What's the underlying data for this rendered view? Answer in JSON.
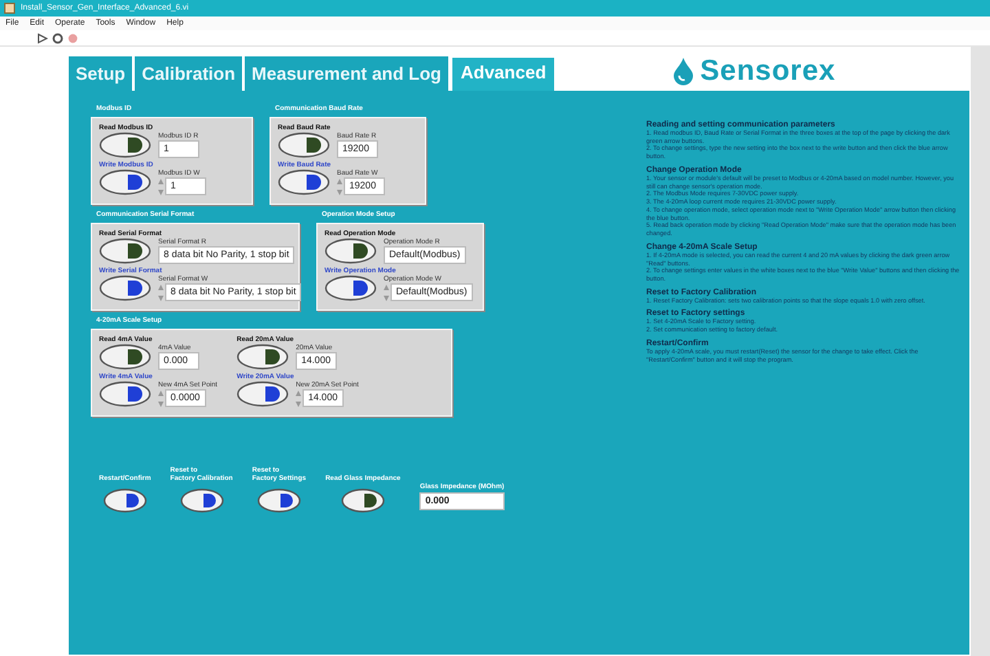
{
  "window": {
    "title": "Install_Sensor_Gen_Interface_Advanced_6.vi"
  },
  "menu": [
    "File",
    "Edit",
    "Operate",
    "Tools",
    "Window",
    "Help"
  ],
  "tabs": [
    {
      "label": "Setup",
      "selected": false
    },
    {
      "label": "Calibration",
      "selected": false
    },
    {
      "label": "Measurement and Log",
      "selected": false
    },
    {
      "label": "Advanced",
      "selected": true
    }
  ],
  "logo": {
    "text": "Sensorex"
  },
  "sections": [
    {
      "title": "Modbus ID",
      "columns": [
        [
          {
            "kind": "read",
            "button_label": "Read Modbus ID",
            "field_label": "Modbus ID R",
            "value": "1"
          },
          {
            "kind": "write",
            "button_label": "Write Modbus ID",
            "field_label": "Modbus ID W",
            "value": "1"
          }
        ]
      ]
    },
    {
      "title": "Communication Baud Rate",
      "columns": [
        [
          {
            "kind": "read",
            "button_label": "Read Baud Rate",
            "field_label": "Baud Rate R",
            "value": "19200"
          },
          {
            "kind": "write",
            "button_label": "Write Baud Rate",
            "field_label": "Baud Rate W",
            "value": "19200"
          }
        ]
      ]
    },
    {
      "title": "Communication Serial Format",
      "columns": [
        [
          {
            "kind": "read",
            "button_label": "Read Serial Format",
            "field_label": "Serial Format R",
            "value": "8 data bit No Parity, 1 stop bit"
          },
          {
            "kind": "write",
            "button_label": "Write Serial Format",
            "field_label": "Serial Format W",
            "value": "8 data bit No Parity, 1 stop bit"
          }
        ]
      ]
    },
    {
      "title": "Operation Mode Setup",
      "columns": [
        [
          {
            "kind": "read",
            "button_label": "Read Operation Mode",
            "field_label": "Operation Mode R",
            "value": "Default(Modbus)"
          },
          {
            "kind": "write",
            "button_label": "Write Operation Mode",
            "field_label": "Operation Mode W",
            "value": "Default(Modbus)"
          }
        ]
      ]
    },
    {
      "title": "4-20mA Scale Setup",
      "columns": [
        [
          {
            "kind": "read",
            "button_label": "Read 4mA Value",
            "field_label": "4mA Value",
            "value": "0.000"
          },
          {
            "kind": "write",
            "button_label": "Write 4mA Value",
            "field_label": "New 4mA Set Point",
            "value": "0.0000"
          }
        ],
        [
          {
            "kind": "read",
            "button_label": "Read 20mA Value",
            "field_label": "20mA Value",
            "value": "14.000"
          },
          {
            "kind": "write",
            "button_label": "Write 20mA Value",
            "field_label": "New 20mA Set Point",
            "value": "14.000"
          }
        ]
      ]
    }
  ],
  "actions": [
    {
      "kind": "write",
      "label": "Restart/Confirm"
    },
    {
      "kind": "write",
      "label": "Reset to\nFactory Calibration"
    },
    {
      "kind": "write",
      "label": "Reset to\nFactory Settings"
    },
    {
      "kind": "read",
      "label": "Read Glass Impedance"
    }
  ],
  "impedance": {
    "label": "Glass Impedance (MOhm)",
    "value": "0.000"
  },
  "help": [
    {
      "heading": "Reading and setting communication parameters",
      "lines": [
        "1. Read modbus ID, Baud Rate or Serial Format in the three boxes at the top of the page by clicking the dark green arrow buttons.",
        "2. To change settings, type the new setting into the box next to the write button and then click the blue arrow button."
      ]
    },
    {
      "heading": "Change Operation Mode",
      "lines": [
        "1. Your sensor or module's default will be preset to Modbus or 4-20mA based on model number. However, you still can change sensor's operation mode.",
        "2. The Modbus Mode requires 7-30VDC power supply.",
        "3. The 4-20mA loop current mode requires 21-30VDC power supply.",
        "4. To change operation mode, select operation mode next to \"Write Operation Mode\" arrow button then clicking the blue button.",
        "5. Read back operation mode by clicking \"Read Operation Mode\" make sure that the operation mode has been changed."
      ]
    },
    {
      "heading": "Change 4-20mA Scale Setup",
      "lines": [
        "1. If 4-20mA mode is selected, you can read the current 4 and 20 mA values by clicking the dark green arrow \"Read\" buttons.",
        "2. To change settings enter values in the white boxes next to the blue \"Write Value\" buttons and then clicking the button."
      ]
    },
    {
      "heading": "Reset to Factory Calibration",
      "lines": [
        "1. Reset Factory Calibration: sets two calibration points so that the slope equals 1.0 with zero offset."
      ]
    },
    {
      "heading": "Reset to Factory settings",
      "lines": [
        "1. Set 4-20mA Scale to Factory setting.",
        "2. Set communication setting to factory default."
      ]
    },
    {
      "heading": "Restart/Confirm",
      "lines": [
        "To apply 4-20mA scale, you must restart(Reset) the sensor for the change to take effect. Click the \"Restart/Confirm\" button and it will stop the program."
      ]
    }
  ]
}
